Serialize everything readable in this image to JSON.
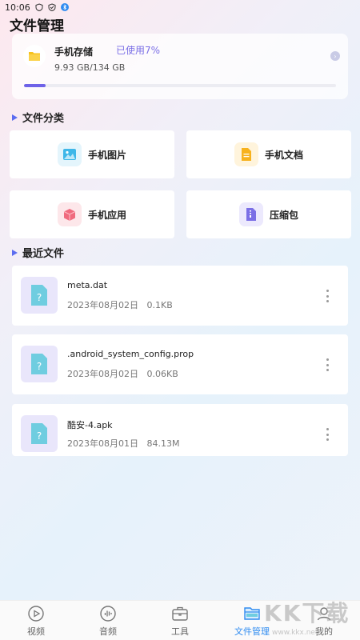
{
  "status_bar": {
    "time": "10:06"
  },
  "header": {
    "title": "文件管理"
  },
  "storage": {
    "name": "手机存储",
    "used_label": "已使用7%",
    "used_fraction": 0.07,
    "size": "9.93 GB/134 GB"
  },
  "categories_section": {
    "title": "文件分类"
  },
  "categories": [
    {
      "label": "手机图片",
      "icon": "image-icon",
      "color": "#3fb7e8"
    },
    {
      "label": "手机文档",
      "icon": "document-icon",
      "color": "#f7b21e"
    },
    {
      "label": "手机应用",
      "icon": "app-cube-icon",
      "color": "#f06b7e"
    },
    {
      "label": "压缩包",
      "icon": "zip-icon",
      "color": "#7b6fe6"
    }
  ],
  "recent_section": {
    "title": "最近文件"
  },
  "recent_files": [
    {
      "name": "meta.dat",
      "date": "2023年08月02日",
      "size": "0.1KB"
    },
    {
      "name": ".android_system_config.prop",
      "date": "2023年08月02日",
      "size": "0.06KB"
    },
    {
      "name": "酷安-4.apk",
      "date": "2023年08月01日",
      "size": "84.13M"
    }
  ],
  "tabs": [
    {
      "label": "视频",
      "icon": "video-icon",
      "active": false
    },
    {
      "label": "音频",
      "icon": "audio-icon",
      "active": false
    },
    {
      "label": "工具",
      "icon": "toolbox-icon",
      "active": false
    },
    {
      "label": "文件管理",
      "icon": "folder-icon",
      "active": true
    },
    {
      "label": "我的",
      "icon": "user-icon",
      "active": false
    }
  ],
  "watermark": {
    "logo": "KK下载",
    "url": "www.kkx.net"
  },
  "colors": {
    "accent": "#6e62e8",
    "tab_active": "#2f8bf0",
    "section_marker": "#5b6cf0"
  }
}
